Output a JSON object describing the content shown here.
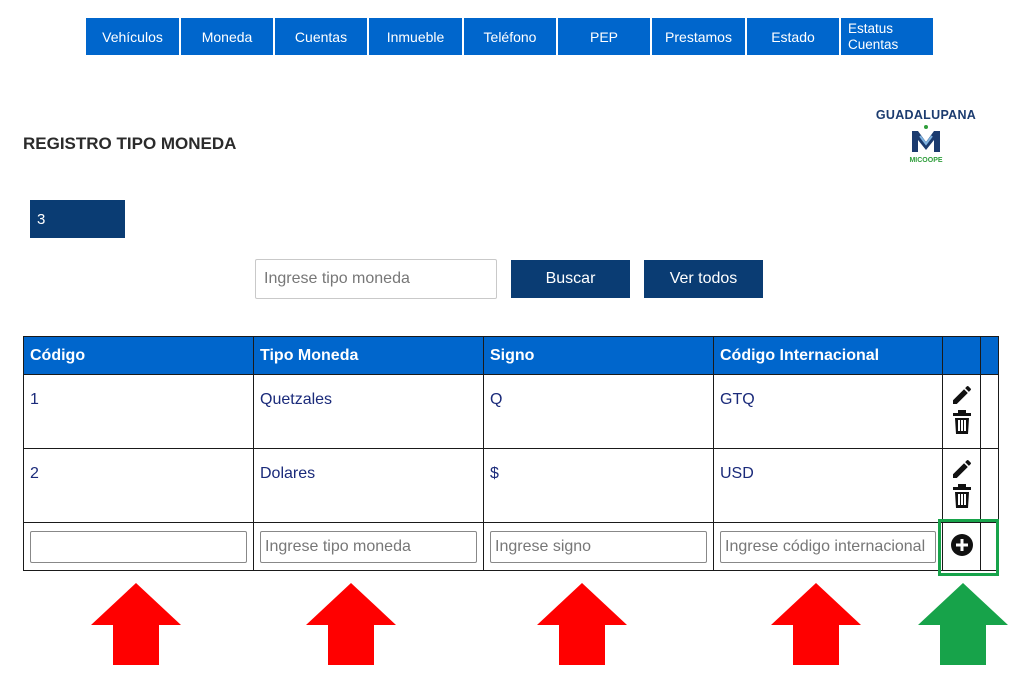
{
  "nav": {
    "items": [
      "Vehículos",
      "Moneda",
      "Cuentas",
      "Inmueble",
      "Teléfono",
      "PEP",
      "Prestamos",
      "Estado"
    ],
    "last_item": {
      "line1": "Estatus",
      "line2": "Cuentas"
    }
  },
  "logo": {
    "name": "GUADALUPANA",
    "sub": "MICOOPE"
  },
  "page": {
    "title": "REGISTRO TIPO MONEDA",
    "count": "3"
  },
  "search": {
    "placeholder": "Ingrese tipo moneda",
    "search_label": "Buscar",
    "view_all_label": "Ver todos"
  },
  "table": {
    "headers": [
      "Código",
      "Tipo Moneda",
      "Signo",
      "Código Internacional"
    ],
    "rows": [
      {
        "codigo": "1",
        "tipo": "Quetzales",
        "signo": "Q",
        "internacional": "GTQ"
      },
      {
        "codigo": "2",
        "tipo": "Dolares",
        "signo": "$",
        "internacional": "USD"
      }
    ],
    "new_row": {
      "codigo_placeholder": "",
      "tipo_placeholder": "Ingrese tipo moneda",
      "signo_placeholder": "Ingrese signo",
      "internacional_placeholder": "Ingrese código internacional"
    }
  },
  "icons": {
    "edit": "pencil-icon",
    "delete": "trash-icon",
    "add": "plus-circle-icon"
  },
  "colors": {
    "nav": "#0066cc",
    "dark_button": "#0a3c73",
    "arrow_red": "#ff0000",
    "arrow_green": "#17a34a",
    "highlight": "#17a34a"
  }
}
